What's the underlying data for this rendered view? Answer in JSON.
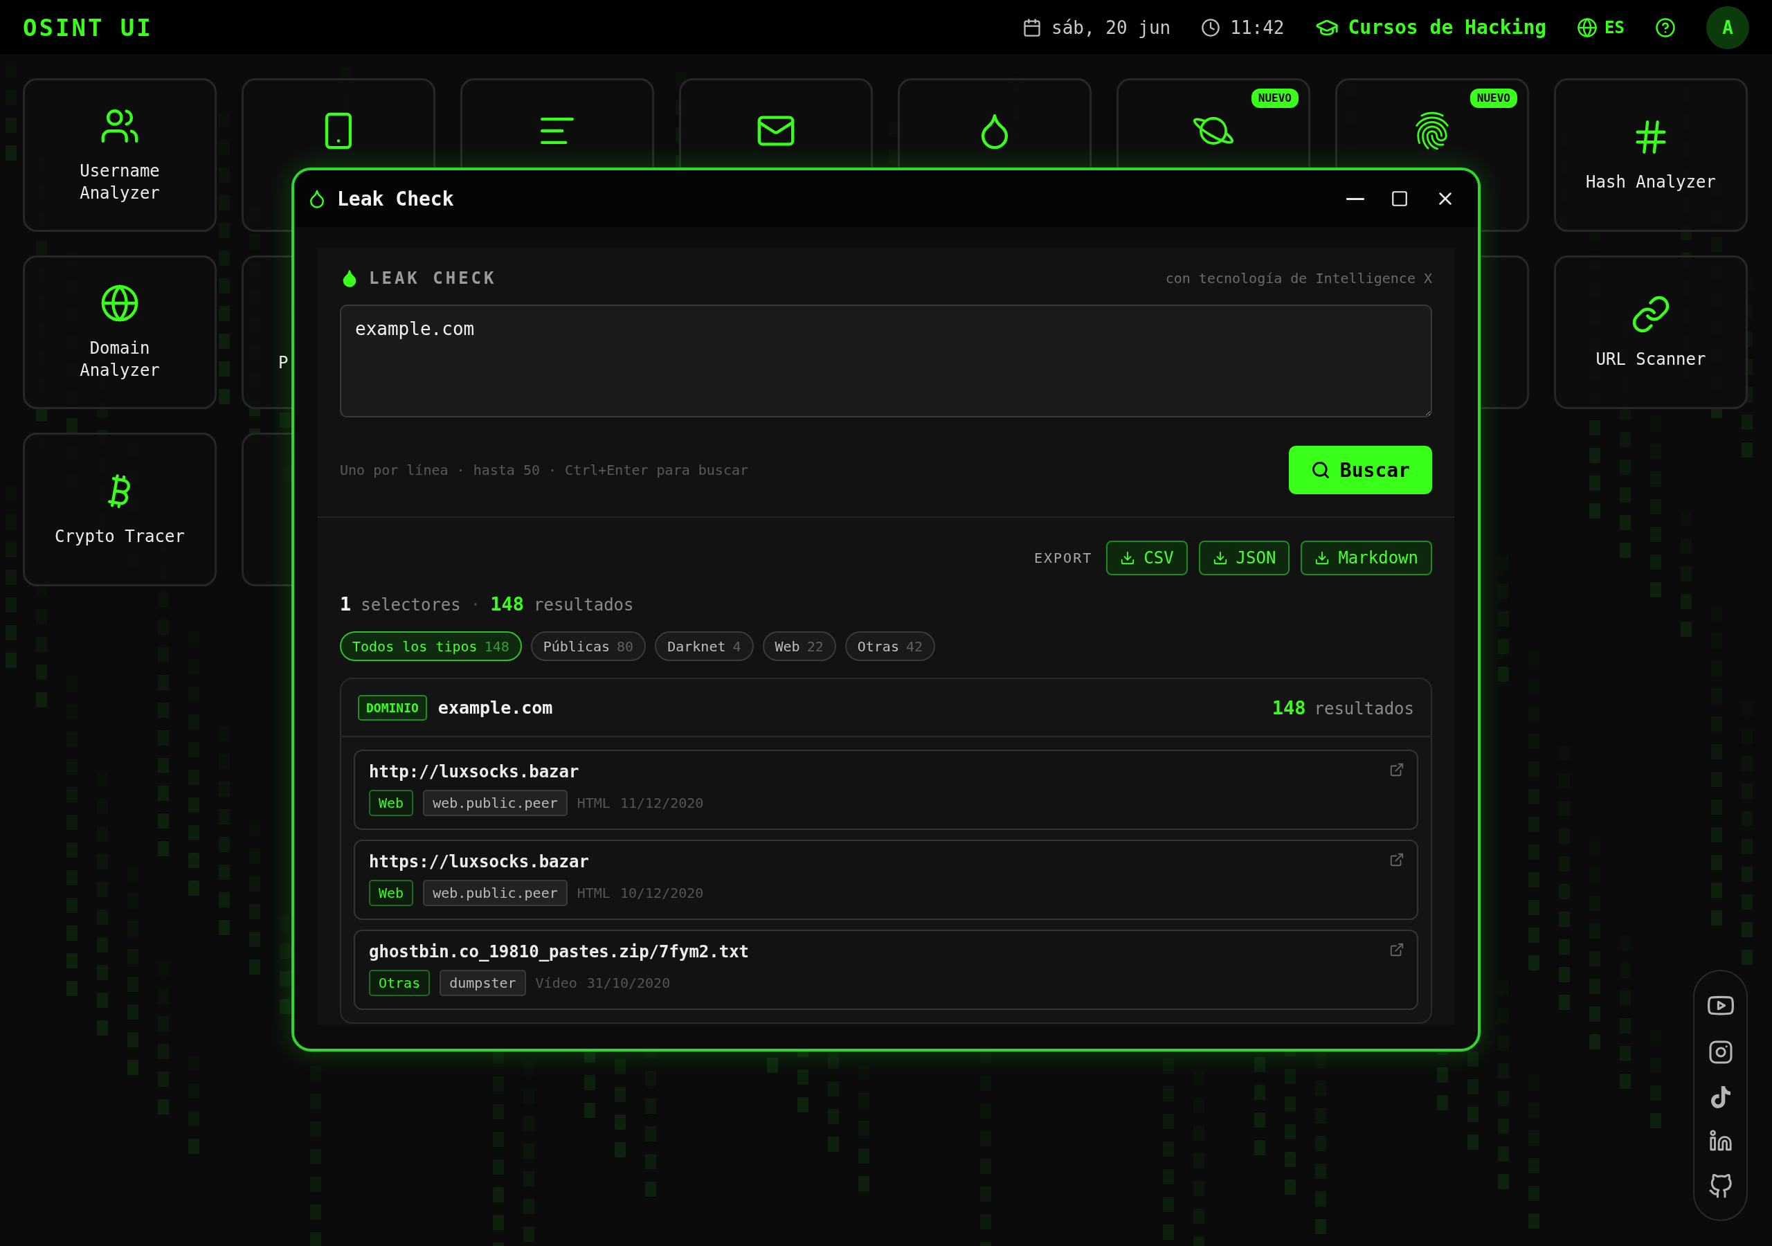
{
  "app_title": "OSINT UI",
  "top_bar": {
    "date": "sáb, 20 jun",
    "time": "11:42",
    "courses_link": "Cursos de Hacking",
    "language": "ES",
    "avatar": "A"
  },
  "tool_rows": [
    {
      "left": [
        {
          "kind": "tool",
          "label": "Username Analyzer"
        },
        {
          "kind": "covered"
        },
        {
          "kind": "covered"
        },
        {
          "kind": "covered"
        },
        {
          "kind": "covered"
        },
        {
          "kind": "covered",
          "badge": "NUEVO"
        },
        {
          "kind": "covered",
          "badge": "NUEVO"
        },
        {
          "kind": "tool",
          "label": "Hash Analyzer"
        }
      ],
      "right": []
    },
    {
      "left": [
        {
          "kind": "tool",
          "label": "Domain Analyzer"
        },
        {
          "kind": "clipped",
          "label": "P"
        }
      ],
      "right": [
        {
          "kind": "blank"
        },
        {
          "kind": "tool",
          "label": "URL Scanner"
        }
      ]
    },
    {
      "left": [
        {
          "kind": "tool",
          "label": "Crypto Tracer"
        },
        {
          "kind": "blank"
        }
      ],
      "right": []
    }
  ],
  "window": {
    "title": "Leak Check",
    "panel_title": "LEAK CHECK",
    "powered_by": "con tecnología de Intelligence X",
    "query": "example.com",
    "hint": "Uno por línea · hasta 50 · Ctrl+Enter para buscar",
    "search_button": "Buscar",
    "export_label": "EXPORT",
    "export_buttons": [
      "CSV",
      "JSON",
      "Markdown"
    ],
    "summary": {
      "selectors": "1",
      "selectors_label": "selectores",
      "separator": "·",
      "results": "148",
      "results_label": "resultados"
    },
    "filters": [
      {
        "label": "Todos los tipos",
        "count": "148",
        "selected": true
      },
      {
        "label": "Públicas",
        "count": "80",
        "selected": false
      },
      {
        "label": "Darknet",
        "count": "4",
        "selected": false
      },
      {
        "label": "Web",
        "count": "22",
        "selected": false
      },
      {
        "label": "Otras",
        "count": "42",
        "selected": false
      }
    ],
    "group": {
      "type": "DOMINIO",
      "value": "example.com",
      "count": "148",
      "count_label": "resultados",
      "results": [
        {
          "url": "http://luxsocks.bazar",
          "category": "Web",
          "bucket": "web.public.peer",
          "media": "HTML",
          "date": "11/12/2020"
        },
        {
          "url": "https://luxsocks.bazar",
          "category": "Web",
          "bucket": "web.public.peer",
          "media": "HTML",
          "date": "10/12/2020"
        },
        {
          "url": "ghostbin.co_19810_pastes.zip/7fym2.txt",
          "category": "Otras",
          "bucket": "dumpster",
          "media": "Vídeo",
          "date": "31/10/2020"
        }
      ]
    }
  }
}
